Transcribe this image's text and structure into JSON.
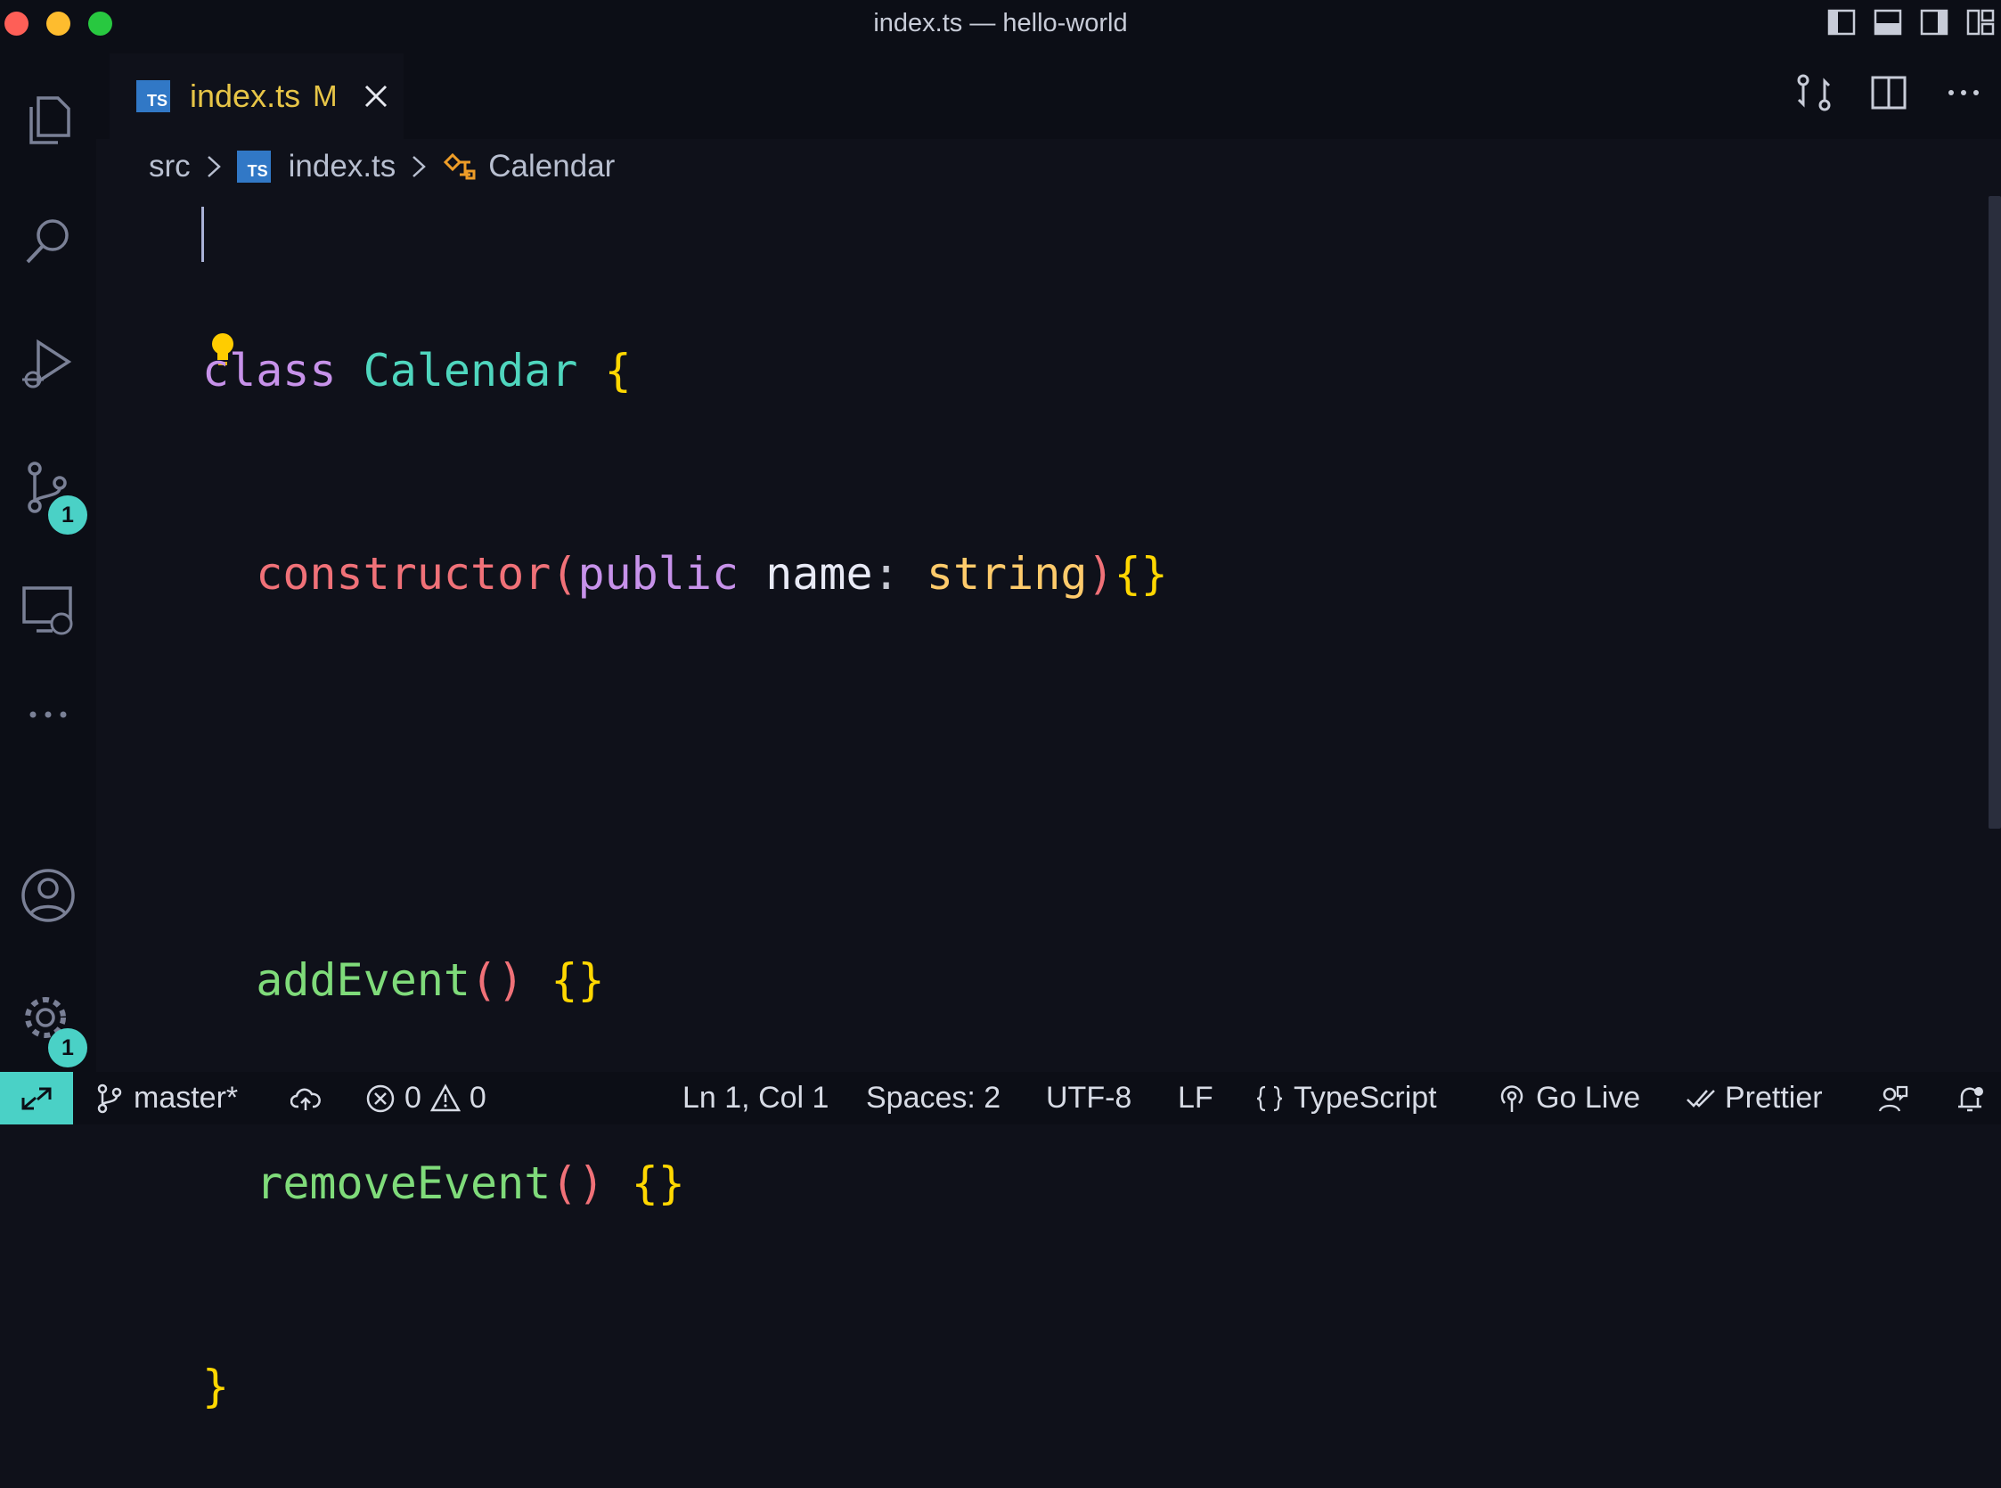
{
  "window": {
    "title": "index.ts — hello-world"
  },
  "activity_bar": {
    "items": [
      {
        "name": "explorer",
        "icon": "files-icon"
      },
      {
        "name": "search",
        "icon": "search-icon"
      },
      {
        "name": "run-and-debug",
        "icon": "run-debug-icon"
      },
      {
        "name": "source-control",
        "icon": "source-control-icon",
        "badge": "1"
      },
      {
        "name": "remote-explorer",
        "icon": "remote-explorer-icon"
      },
      {
        "name": "more",
        "icon": "ellipsis-icon"
      }
    ],
    "accounts_icon": "account-icon",
    "manage": {
      "icon": "gear-icon",
      "badge": "1"
    }
  },
  "tab": {
    "icon_text": "TS",
    "filename": "index.ts",
    "status": "M"
  },
  "breadcrumb": {
    "folder": "src",
    "file": "index.ts",
    "symbol": "Calendar"
  },
  "code": {
    "line1": {
      "kw": "class",
      "name": "Calendar",
      "brace": "{"
    },
    "line2": {
      "ctor": "constructor",
      "open": "(",
      "mod": "public",
      "param": "name",
      "colon": ":",
      "type": "string",
      "close": ")",
      "body": "{}"
    },
    "line4": {
      "method": "addEvent",
      "parens": "()",
      "body": "{}"
    },
    "line5": {
      "method": "removeEvent",
      "parens": "()",
      "body": "{}"
    },
    "line6": {
      "brace": "}"
    }
  },
  "status_bar": {
    "branch": "master*",
    "errors": "0",
    "warnings": "0",
    "position": "Ln 1, Col 1",
    "spaces": "Spaces: 2",
    "encoding": "UTF-8",
    "eol": "LF",
    "language": "TypeScript",
    "go_live": "Go Live",
    "prettier": "Prettier"
  },
  "colors": {
    "accent": "#4ad1c6",
    "background": "#0f111a",
    "modified": "#e7c547"
  }
}
